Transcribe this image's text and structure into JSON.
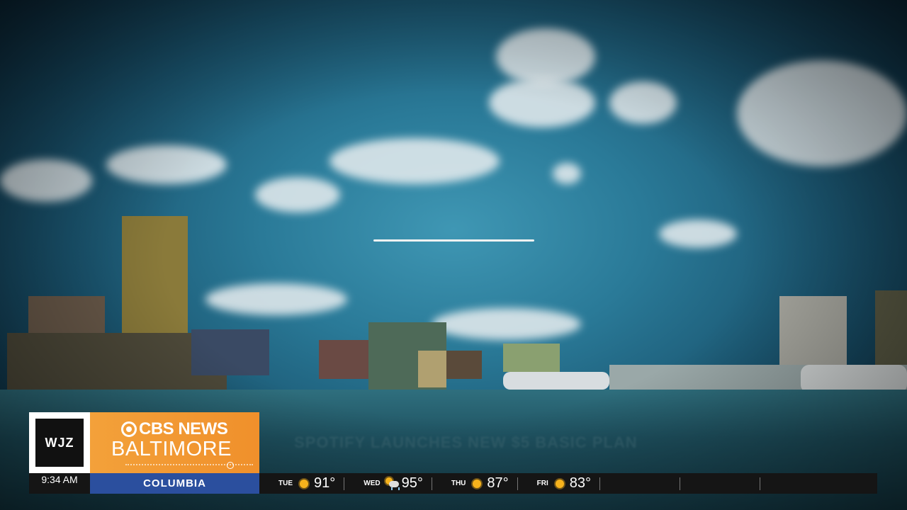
{
  "broadcast": {
    "station_logo": "WJZ",
    "network_name": "CBS NEWS",
    "city": "BALTIMORE",
    "ghost_headline": "SPOTIFY LAUNCHES NEW $5 BASIC PLAN"
  },
  "ticker": {
    "time": "9:34 AM",
    "location": "COLUMBIA",
    "forecast": [
      {
        "day": "TUE",
        "icon": "sun-icon",
        "temp": "91°"
      },
      {
        "day": "WED",
        "icon": "storm-cloud-icon",
        "temp": "95°"
      },
      {
        "day": "THU",
        "icon": "sun-icon",
        "temp": "87°"
      },
      {
        "day": "FRI",
        "icon": "sun-icon",
        "temp": "83°"
      }
    ]
  },
  "colors": {
    "brand_orange": "#f3a13a",
    "location_blue": "#2b4f9e",
    "ticker_bg": "#151515"
  }
}
